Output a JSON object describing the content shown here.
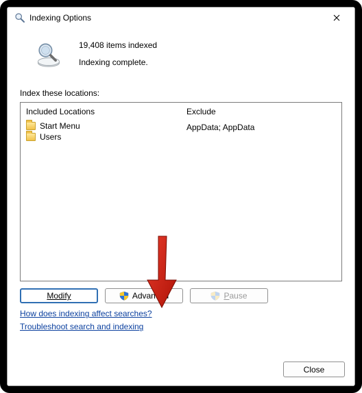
{
  "titlebar": {
    "title": "Indexing Options"
  },
  "status": {
    "count_line": "19,408 items indexed",
    "state_line": "Indexing complete."
  },
  "section_label": "Index these locations:",
  "columns": {
    "included_header": "Included Locations",
    "exclude_header": "Exclude"
  },
  "included": [
    {
      "label": "Start Menu"
    },
    {
      "label": "Users"
    }
  ],
  "excluded": [
    "",
    "AppData; AppData"
  ],
  "buttons": {
    "modify": "Modify",
    "advanced": "Advanced",
    "pause_prefix": "P",
    "pause_rest": "ause"
  },
  "links": {
    "help": "How does indexing affect searches?",
    "troubleshoot": "Troubleshoot search and indexing"
  },
  "footer": {
    "close": "Close"
  }
}
